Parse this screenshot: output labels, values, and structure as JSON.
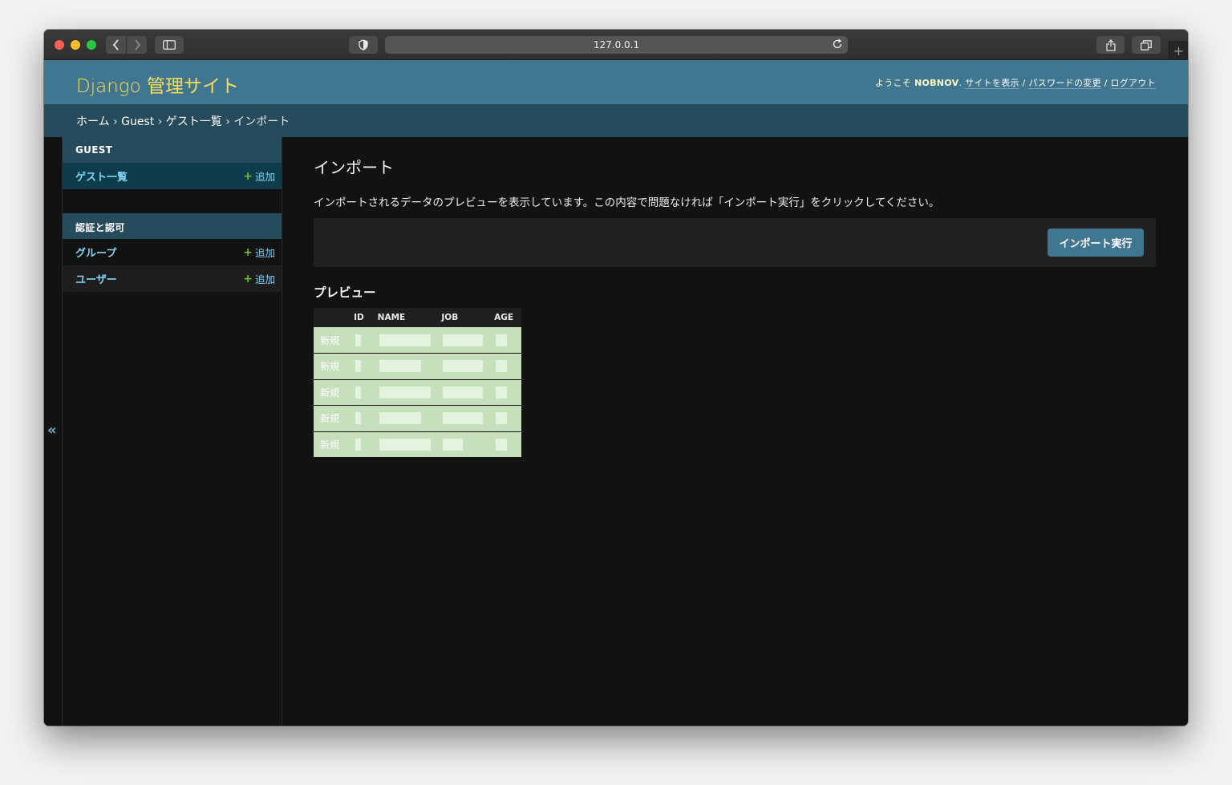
{
  "browser": {
    "url": "127.0.0.1"
  },
  "header": {
    "branding": "Django 管理サイト",
    "welcome": "ようこそ",
    "username": "NOBNOV",
    "view_site": "サイトを表示",
    "change_password": "パスワードの変更",
    "logout": "ログアウト",
    "separator": "/"
  },
  "breadcrumbs": {
    "home": "ホーム",
    "app": "Guest",
    "model": "ゲスト一覧",
    "current": "インポート",
    "separator": "›"
  },
  "nav": {
    "collapse_label": "«",
    "modules": [
      {
        "caption": "GUEST",
        "models": [
          {
            "label": "ゲスト一覧",
            "add": "追加"
          }
        ]
      },
      {
        "caption": "認証と認可",
        "models": [
          {
            "label": "グループ",
            "add": "追加"
          },
          {
            "label": "ユーザー",
            "add": "追加"
          }
        ]
      }
    ]
  },
  "content": {
    "title": "インポート",
    "intro": "インポートされるデータのプレビューを表示しています。この内容で問題なければ「インポート実行」をクリックしてください。",
    "submit_label": "インポート実行",
    "preview_heading": "プレビュー"
  },
  "preview_table": {
    "columns": [
      "",
      "ID",
      "NAME",
      "JOB",
      "AGE"
    ],
    "rows": [
      {
        "status": "新規"
      },
      {
        "status": "新規"
      },
      {
        "status": "新規"
      },
      {
        "status": "新規"
      },
      {
        "status": "新規"
      }
    ]
  },
  "colors": {
    "header_bg": "#417690",
    "branding": "#f5dd5d",
    "breadcrumbs_bg": "#264b5d",
    "link": "#81d4fa",
    "add_icon": "#70bf2b",
    "new_row_bg": "#c6dfbc",
    "button_bg": "#417690"
  }
}
